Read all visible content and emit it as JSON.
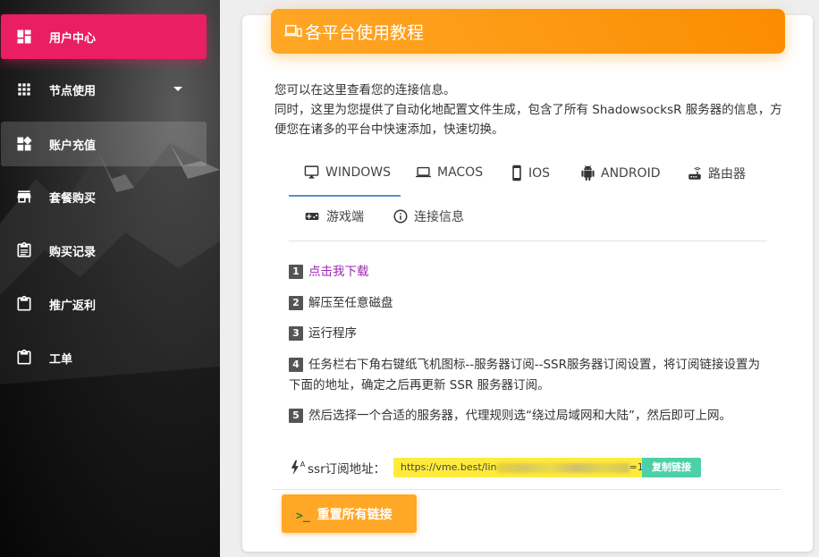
{
  "sidebar": {
    "items": [
      {
        "label": "用户中心",
        "icon": "dashboard-icon",
        "active": true
      },
      {
        "label": "节点使用",
        "icon": "grid-icon",
        "has_caret": true
      },
      {
        "label": "账户充值",
        "icon": "widgets-icon",
        "hover": true
      },
      {
        "label": "套餐购买",
        "icon": "store-icon"
      },
      {
        "label": "购买记录",
        "icon": "assignment-icon"
      },
      {
        "label": "推广返利",
        "icon": "clipboard-icon"
      },
      {
        "label": "工单",
        "icon": "clipboard-icon"
      }
    ]
  },
  "card": {
    "title": "各平台使用教程",
    "title_icon": "devices-icon",
    "intro_line1": "您可以在这里查看您的连接信息。",
    "intro_line2": "同时，这里为您提供了自动化地配置文件生成，包含了所有 ShadowsocksR 服务器的信息，方便您在诸多的平台中快速添加，快速切换。",
    "tabs": [
      {
        "label": "WINDOWS",
        "icon": "desktop-icon",
        "active": true
      },
      {
        "label": "MACOS",
        "icon": "laptop-icon"
      },
      {
        "label": "IOS",
        "icon": "phone-icon"
      },
      {
        "label": "ANDROID",
        "icon": "android-icon"
      },
      {
        "label": "路由器",
        "icon": "router-icon"
      },
      {
        "label": "游戏端",
        "icon": "gamepad-icon"
      },
      {
        "label": "连接信息",
        "icon": "info-icon"
      }
    ],
    "steps": [
      {
        "num": "1",
        "text": "点击我下载"
      },
      {
        "num": "2",
        "text": "解压至任意磁盘"
      },
      {
        "num": "3",
        "text": "运行程序"
      },
      {
        "num": "4",
        "text": "任务栏右下角右键纸飞机图标--服务器订阅--SSR服务器订阅设置，将订阅链接设置为下面的地址，确定之后再更新 SSR 服务器订阅。"
      },
      {
        "num": "5",
        "text": "然后选择一个合适的服务器，代理规则选“绕过局域网和大陆”，然后即可上网。"
      }
    ],
    "ssr_label": "ssr订阅地址：",
    "ssr_url_prefix": "https://vme.best/lin",
    "ssr_url_suffix": "=1",
    "copy_label": "复制链接",
    "reset_prompt": ">_",
    "reset_label": "重置所有链接"
  },
  "colors": {
    "active_nav": "#e91e63",
    "header": "#fb8c00",
    "link": "#9c27b0",
    "url_bg": "#ffeb3b",
    "copy_bg": "#4dd0a8"
  }
}
